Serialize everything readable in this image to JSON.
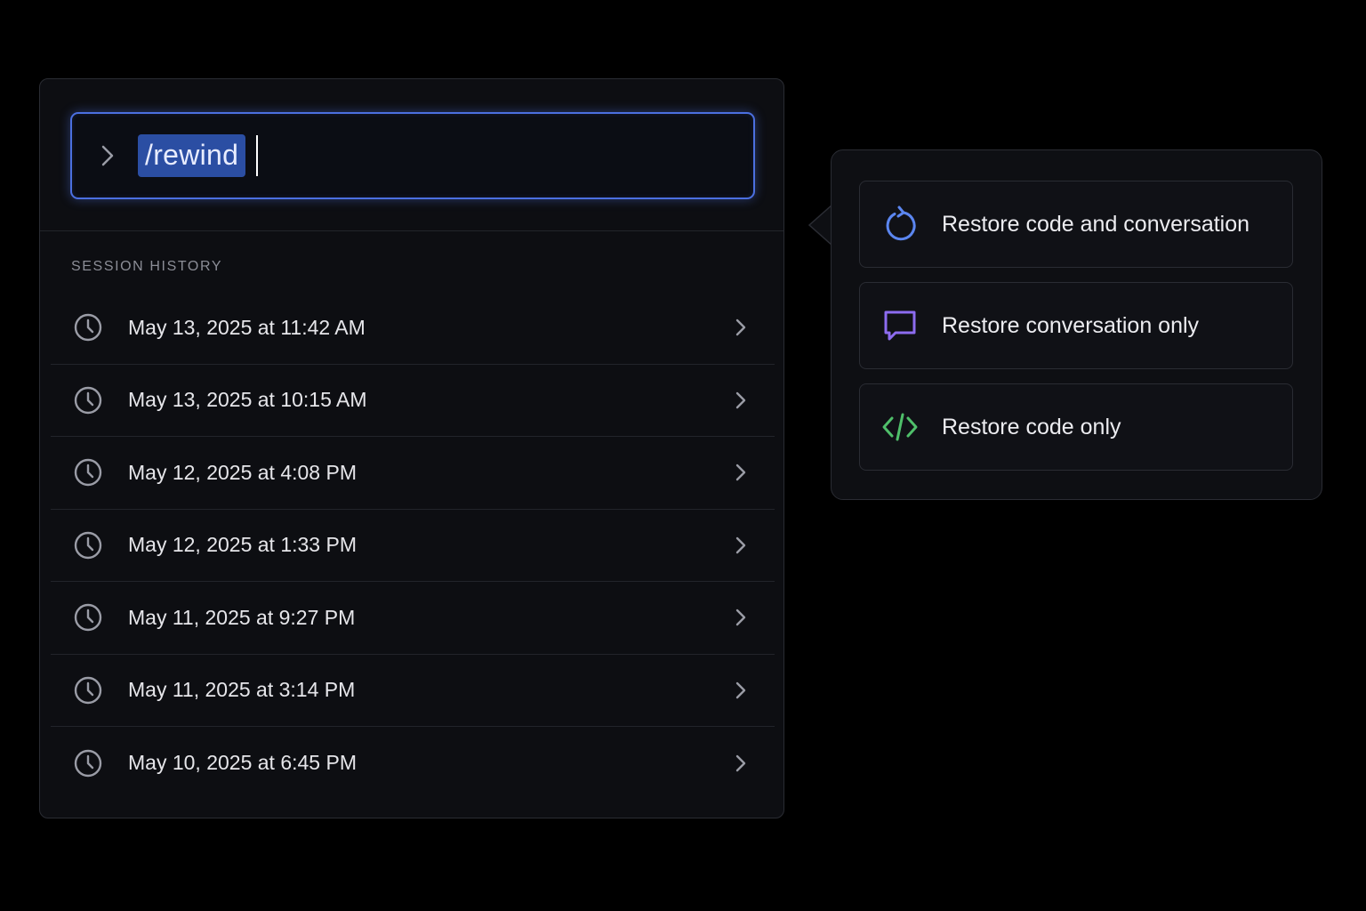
{
  "prompt": {
    "command": "/rewind"
  },
  "history": {
    "section_label": "SESSION HISTORY",
    "items": [
      {
        "label": "May 13, 2025 at 11:42 AM"
      },
      {
        "label": "May 13, 2025 at 10:15 AM"
      },
      {
        "label": "May 12, 2025 at 4:08 PM"
      },
      {
        "label": "May 12, 2025 at 1:33 PM"
      },
      {
        "label": "May 11, 2025 at 9:27 PM"
      },
      {
        "label": "May 11, 2025 at 3:14 PM"
      },
      {
        "label": "May 10, 2025 at 6:45 PM"
      }
    ]
  },
  "restore_menu": {
    "options": [
      {
        "label": "Restore code and conversation",
        "icon": "restore-icon",
        "color": "#5b86f0"
      },
      {
        "label": "Restore conversation only",
        "icon": "chat-bubble-icon",
        "color": "#8d6cf0"
      },
      {
        "label": "Restore code only",
        "icon": "code-brackets-icon",
        "color": "#4fbf6a"
      }
    ]
  },
  "colors": {
    "accent": "#4b6fe0",
    "selection": "#2b4ea3",
    "background": "#000000",
    "panel": "#0d0e12"
  }
}
